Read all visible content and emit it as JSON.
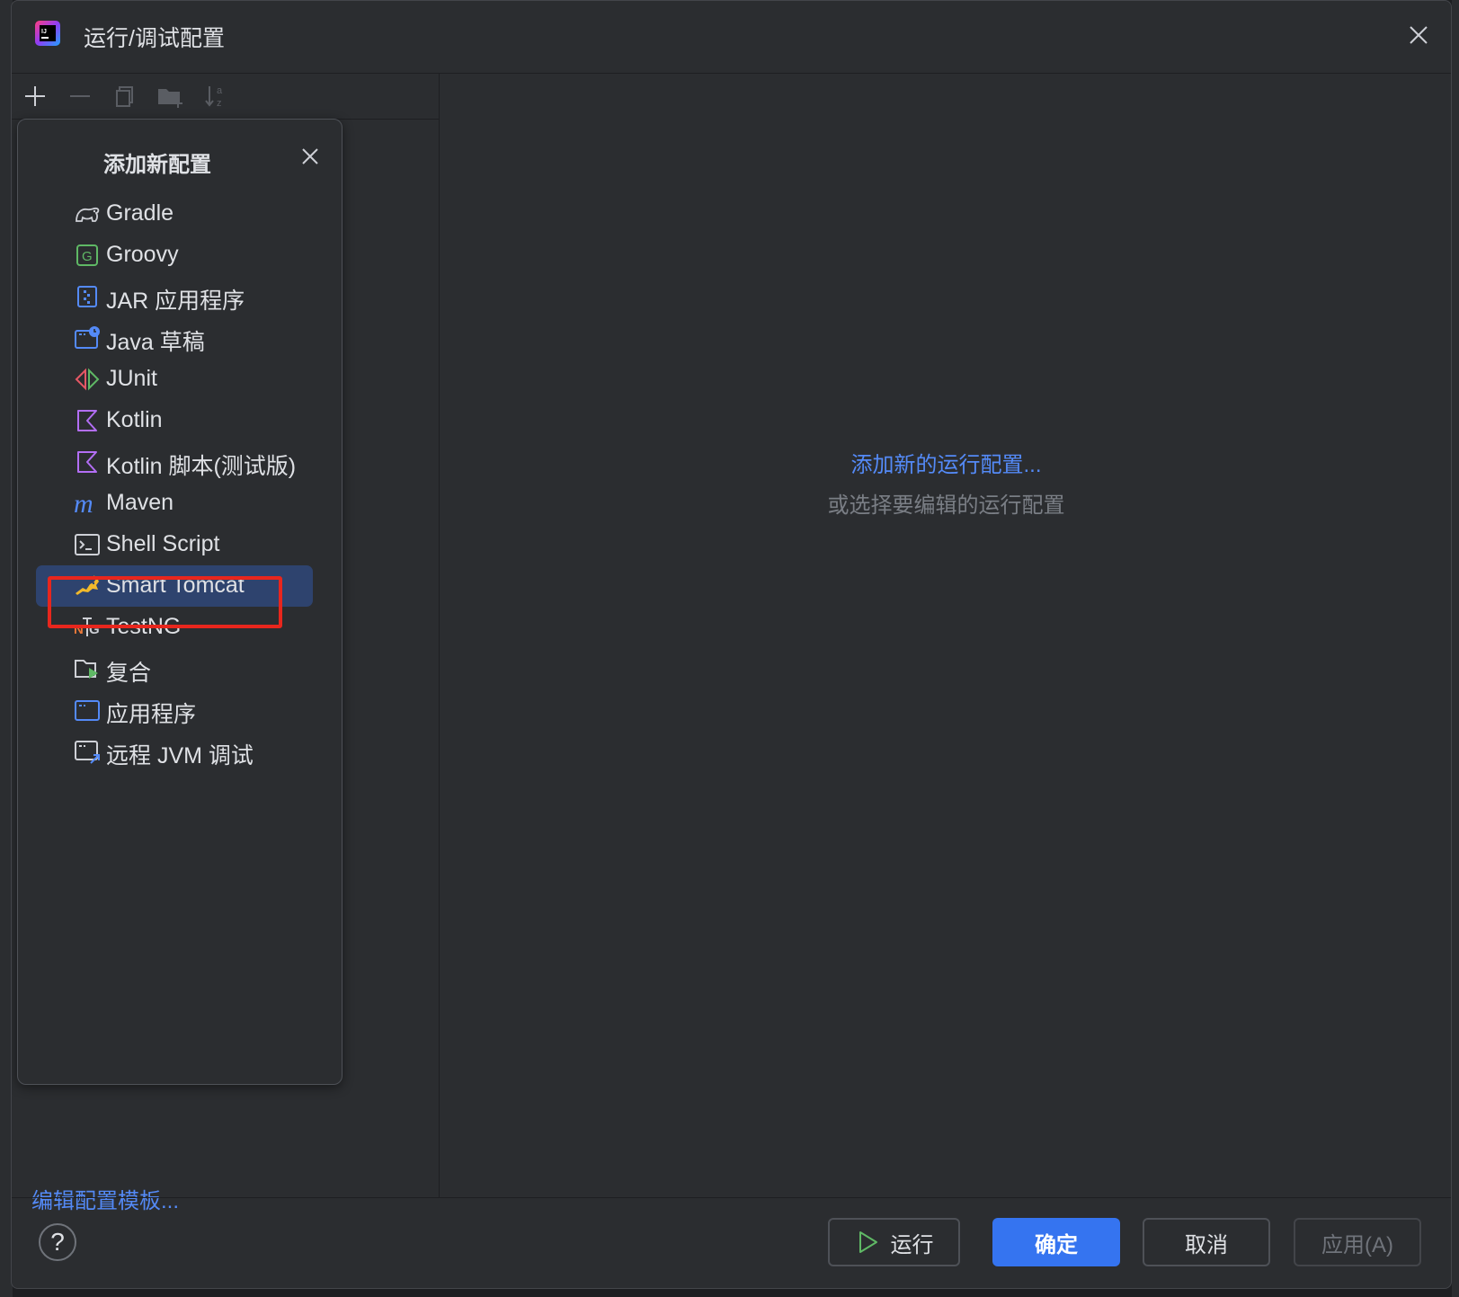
{
  "window": {
    "title": "运行/调试配置"
  },
  "popup": {
    "title": "添加新配置",
    "items": [
      {
        "label": "Gradle",
        "icon": "gradle-icon"
      },
      {
        "label": "Groovy",
        "icon": "groovy-icon"
      },
      {
        "label": "JAR 应用程序",
        "icon": "jar-application-icon"
      },
      {
        "label": "Java 草稿",
        "icon": "java-scratch-icon"
      },
      {
        "label": "JUnit",
        "icon": "junit-icon"
      },
      {
        "label": "Kotlin",
        "icon": "kotlin-icon"
      },
      {
        "label": "Kotlin 脚本(测试版)",
        "icon": "kotlin-script-icon"
      },
      {
        "label": "Maven",
        "icon": "maven-icon"
      },
      {
        "label": "Shell Script",
        "icon": "shell-script-icon"
      },
      {
        "label": "Smart Tomcat",
        "icon": "tomcat-icon",
        "selected": true
      },
      {
        "label": "TestNG",
        "icon": "testng-icon"
      },
      {
        "label": "复合",
        "icon": "compound-icon"
      },
      {
        "label": "应用程序",
        "icon": "application-icon"
      },
      {
        "label": "远程 JVM 调试",
        "icon": "remote-jvm-debug-icon"
      }
    ]
  },
  "left": {
    "edit_templates": "编辑配置模板..."
  },
  "main": {
    "add_new_link": "添加新的运行配置...",
    "hint": "或选择要编辑的运行配置"
  },
  "footer": {
    "help": "?",
    "run": "运行",
    "ok": "确定",
    "cancel": "取消",
    "apply": "应用(A)"
  },
  "colors": {
    "accent": "#3574f0",
    "link": "#548af7",
    "highlight": "#e8261d",
    "selected_row": "#2e436e"
  }
}
